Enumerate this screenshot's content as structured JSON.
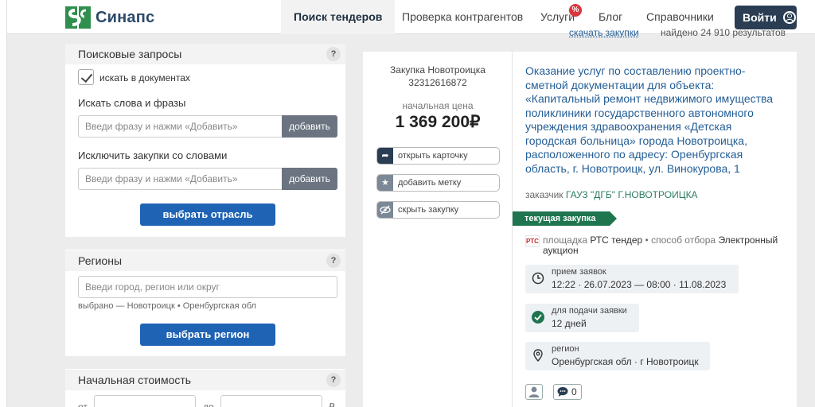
{
  "header": {
    "brand": "Синапс",
    "nav": [
      "Поиск тендеров",
      "Проверка контрагентов",
      "Услуги",
      "Блог",
      "Справочники"
    ],
    "services_badge": "%",
    "login": "Войти"
  },
  "results_bar": {
    "download": "скачать закупки",
    "found": "найдено 24 910 результатов"
  },
  "filters": {
    "search_queries": {
      "title": "Поисковые запросы",
      "help": "?",
      "search_in_docs": "искать в документах",
      "search_words_label": "Искать слова и фразы",
      "search_words_placeholder": "Введи фразу и нажми «Добавить»",
      "add": "добавить",
      "exclude_label": "Исключить закупки со словами",
      "exclude_placeholder": "Введи фразу и нажми «Добавить»",
      "choose_industry": "выбрать отрасль"
    },
    "regions": {
      "title": "Регионы",
      "help": "?",
      "placeholder": "Введи город, регион или округ",
      "selected": "выбрано — Новотроицк • Оренбургская обл",
      "choose_region": "выбрать регион"
    },
    "initial_price": {
      "title": "Начальная стоимость",
      "help": "?",
      "from": "от",
      "to": "до",
      "currency": "₽"
    }
  },
  "tender": {
    "location_label": "Закупка Новотроицка",
    "number": "32312616872",
    "price_label": "начальная цена",
    "price": "1 369 200₽",
    "actions": {
      "open_card": "открыть карточку",
      "add_tag": "добавить метку",
      "hide": "скрыть закупку"
    },
    "title": "Оказание услуг по составлению проектно-сметной документации для объекта: «Капитальный ремонт недвижимого имущества поликлиники государственного автономного учреждения здравоохранения «Детская городская больница» города Новотроицка, расположенного по адресу: Оренбургская область, г. Новотроицк, ул. Винокурова, 1",
    "customer_label": "заказчик",
    "customer": "ГАУЗ \"ДГБ\" Г.НОВОТРОИЦКА",
    "status": "текущая закупка",
    "platform_logo": "РТС",
    "platform_label": "площадка",
    "platform": "РТС тендер",
    "method_label": "способ отбора",
    "method": "Электронный аукцион",
    "accept_label": "прием заявок",
    "accept_period": "12:22 · 26.07.2023 — 08:00 · 11.08.2023",
    "deadline_label": "для подачи заявки",
    "deadline": "12 дней",
    "region_label": "регион",
    "region": "Оренбургская обл · г Новотроицк",
    "comments_count": "0"
  }
}
